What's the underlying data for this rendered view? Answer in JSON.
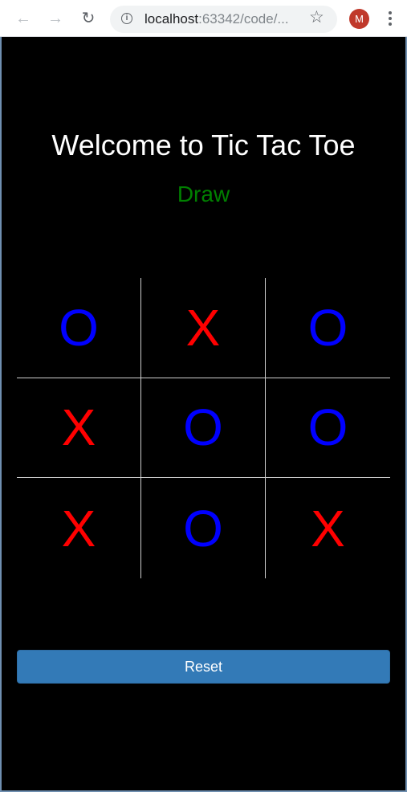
{
  "browser": {
    "url_host": "localhost",
    "url_rest": ":63342/code/...",
    "avatar_letter": "M"
  },
  "app": {
    "title": "Welcome to Tic Tac Toe",
    "status": "Draw",
    "reset_label": "Reset"
  },
  "colors": {
    "x": "#ff0000",
    "o": "#0000ff",
    "status": "#008000"
  },
  "board": [
    [
      "O",
      "X",
      "O"
    ],
    [
      "X",
      "O",
      "O"
    ],
    [
      "X",
      "O",
      "X"
    ]
  ]
}
